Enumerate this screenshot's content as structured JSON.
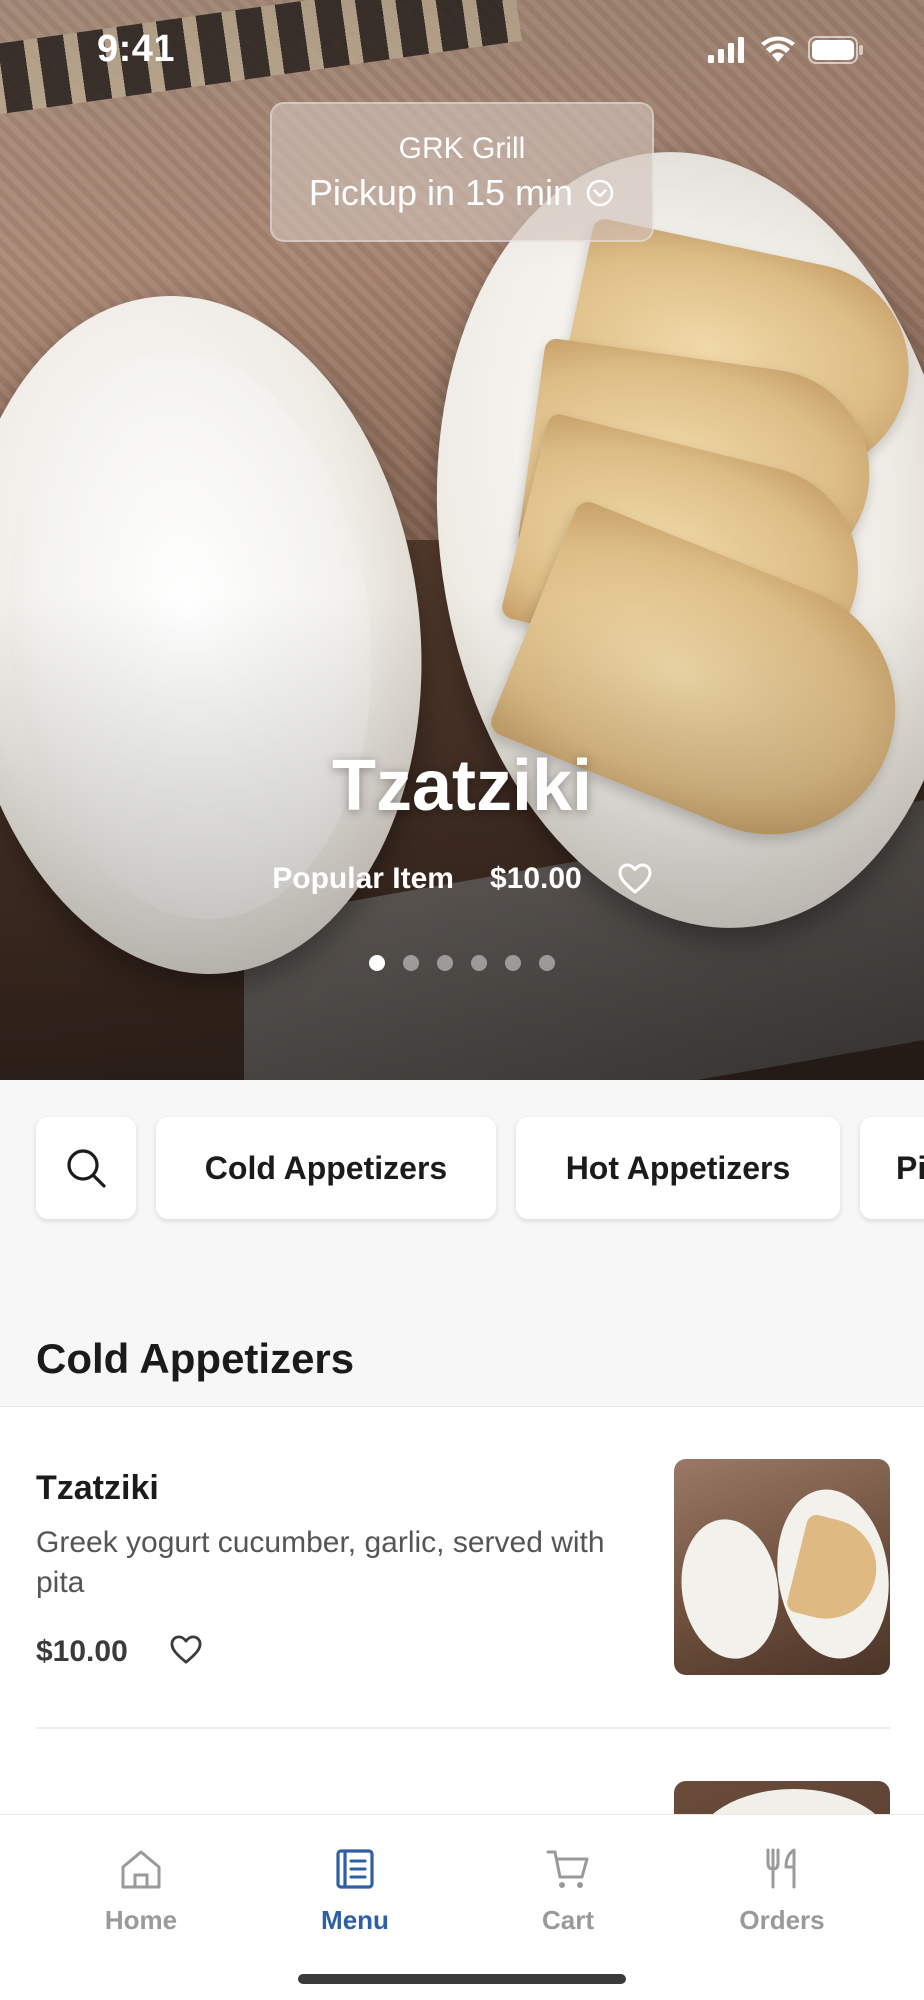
{
  "status_bar": {
    "time": "9:41"
  },
  "store": {
    "name": "GRK Grill",
    "pickup": "Pickup in 15 min"
  },
  "featured": {
    "title": "Tzatziki",
    "tag": "Popular Item",
    "price": "$10.00",
    "carousel": {
      "count": 6,
      "active_index": 0
    }
  },
  "categories": {
    "chips": [
      "Cold Appetizers",
      "Hot Appetizers",
      "Pi"
    ]
  },
  "section": {
    "title": "Cold Appetizers"
  },
  "items": [
    {
      "name": "Tzatziki",
      "description": "Greek yogurt cucumber, garlic, served with pita",
      "price": "$10.00"
    }
  ],
  "tabbar": {
    "home": "Home",
    "menu": "Menu",
    "cart": "Cart",
    "orders": "Orders",
    "active": "Menu"
  },
  "colors": {
    "accent": "#2f5ea8",
    "inactive_tab": "#9a9a9a",
    "text": "#1b1b1b"
  }
}
